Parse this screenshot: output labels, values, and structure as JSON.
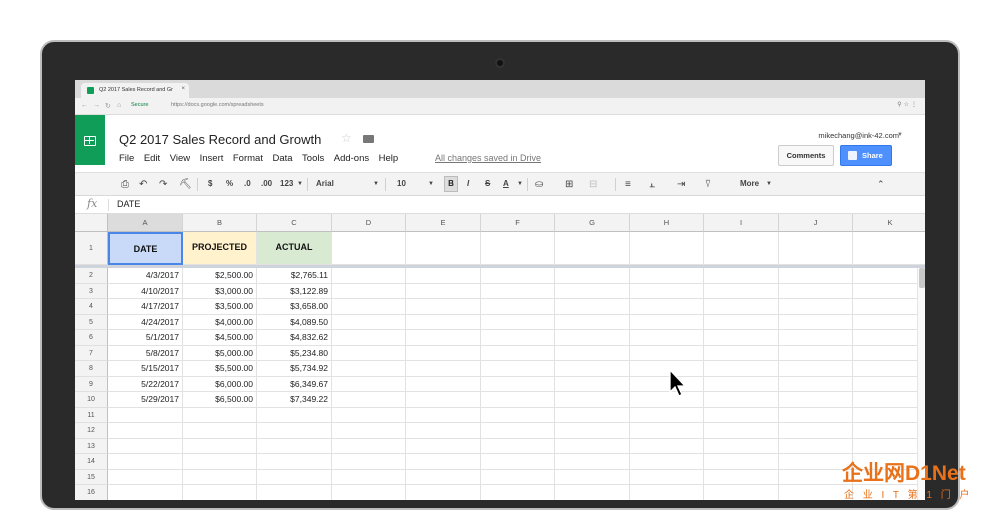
{
  "browser": {
    "tab_title": "Q2 2017 Sales Record and Gr",
    "tab_close": "×",
    "secure_label": "Secure",
    "url_host": "https://docs.google.com",
    "url_path": "/spreadsheets"
  },
  "doc": {
    "title": "Q2 2017 Sales Record and Growth",
    "menus": [
      "File",
      "Edit",
      "View",
      "Insert",
      "Format",
      "Data",
      "Tools",
      "Add-ons",
      "Help"
    ],
    "saved_status": "All changes saved in Drive",
    "user_email": "mikechang@ink-42.com",
    "comments_label": "Comments",
    "share_label": "Share"
  },
  "toolbar": {
    "currency": "$",
    "percent": "%",
    "dec_less": ".0",
    "dec_more": ".00",
    "format_123": "123",
    "font": "Arial",
    "font_size": "10",
    "bold": "B",
    "italic": "I",
    "strike": "S",
    "text_color": "A",
    "more": "More"
  },
  "formula_bar": {
    "fx": "fx",
    "value": "DATE"
  },
  "sheet": {
    "columns": [
      "A",
      "B",
      "C",
      "D",
      "E",
      "F",
      "G",
      "H",
      "I",
      "J",
      "K"
    ],
    "row_numbers": [
      "1",
      "2",
      "3",
      "4",
      "5",
      "6",
      "7",
      "8",
      "9",
      "10",
      "11",
      "12",
      "13",
      "14",
      "15",
      "16"
    ],
    "headers": [
      "DATE",
      "PROJECTED",
      "ACTUAL"
    ],
    "header_colors": [
      "#c9daf8",
      "#fff2cc",
      "#d9ead3"
    ],
    "rows": [
      [
        "4/3/2017",
        "$2,500.00",
        "$2,765.11"
      ],
      [
        "4/10/2017",
        "$3,000.00",
        "$3,122.89"
      ],
      [
        "4/17/2017",
        "$3,500.00",
        "$3,658.00"
      ],
      [
        "4/24/2017",
        "$4,000.00",
        "$4,089.50"
      ],
      [
        "5/1/2017",
        "$4,500.00",
        "$4,832.62"
      ],
      [
        "5/8/2017",
        "$5,000.00",
        "$5,234.80"
      ],
      [
        "5/15/2017",
        "$5,500.00",
        "$5,734.92"
      ],
      [
        "5/22/2017",
        "$6,000.00",
        "$6,349.67"
      ],
      [
        "5/29/2017",
        "$6,500.00",
        "$7,349.22"
      ]
    ]
  },
  "watermark": {
    "line1": "企业网D1Net",
    "line2": "企 业 I T 第 1 门 户"
  }
}
